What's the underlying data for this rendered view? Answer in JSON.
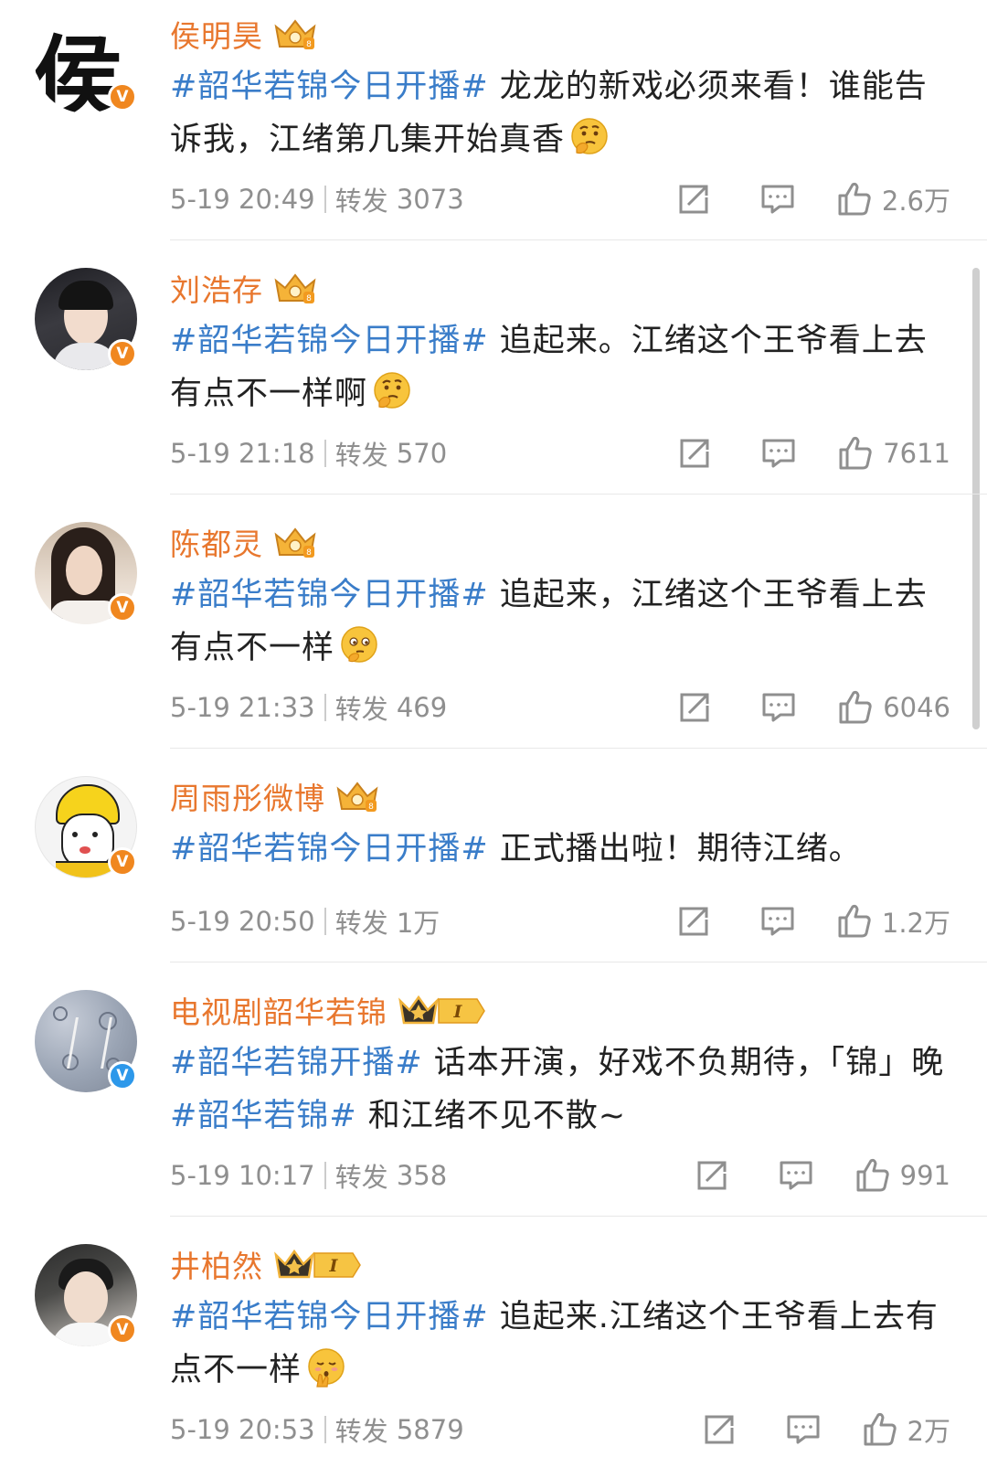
{
  "posts": [
    {
      "user": "侯明昊",
      "verify": "V",
      "hashtag": "#韶华若锦今日开播#",
      "text": " 龙龙的新戏必须来看！谁能告诉我，江绪第几集开始真香",
      "time": "5-19 20:49",
      "repost_label": "转发",
      "reposts": "3073",
      "likes": "2.6万"
    },
    {
      "user": "刘浩存",
      "verify": "V",
      "hashtag": "#韶华若锦今日开播#",
      "text": " 追起来。江绪这个王爷看上去有点不一样啊",
      "time": "5-19 21:18",
      "repost_label": "转发",
      "reposts": "570",
      "likes": "7611"
    },
    {
      "user": "陈都灵",
      "verify": "V",
      "hashtag": "#韶华若锦今日开播#",
      "text": " 追起来，江绪这个王爷看上去有点不一样",
      "time": "5-19 21:33",
      "repost_label": "转发",
      "reposts": "469",
      "likes": "6046"
    },
    {
      "user": "周雨彤微博",
      "verify": "V",
      "hashtag": "#韶华若锦今日开播#",
      "text": " 正式播出啦！期待江绪。",
      "time": "5-19 20:50",
      "repost_label": "转发",
      "reposts": "1万",
      "likes": "1.2万"
    },
    {
      "user": "电视剧韶华若锦",
      "verify": "V",
      "level": "I",
      "hashtag": "#韶华若锦开播#",
      "text_1": " 话本开演，好戏不负期待，「锦」晚",
      "hashtag_2": "#韶华若锦#",
      "text_2": " 和江绪不见不散~",
      "time": "5-19 10:17",
      "repost_label": "转发",
      "reposts": "358",
      "likes": "991"
    },
    {
      "user": "井柏然",
      "verify": "V",
      "level": "I",
      "hashtag": "#韶华若锦今日开播#",
      "text": " 追起来.江绪这个王爷看上去有点不一样",
      "time": "5-19 20:53",
      "repost_label": "转发",
      "reposts": "5879",
      "likes": "2万"
    }
  ],
  "avatar_text": {
    "p1": "侯"
  },
  "colors": {
    "name": "#e8772e",
    "hashtag": "#3a7dc9",
    "meta": "#8f8f8f",
    "badge_orange": "#f0871f",
    "badge_blue": "#2d98ea"
  }
}
